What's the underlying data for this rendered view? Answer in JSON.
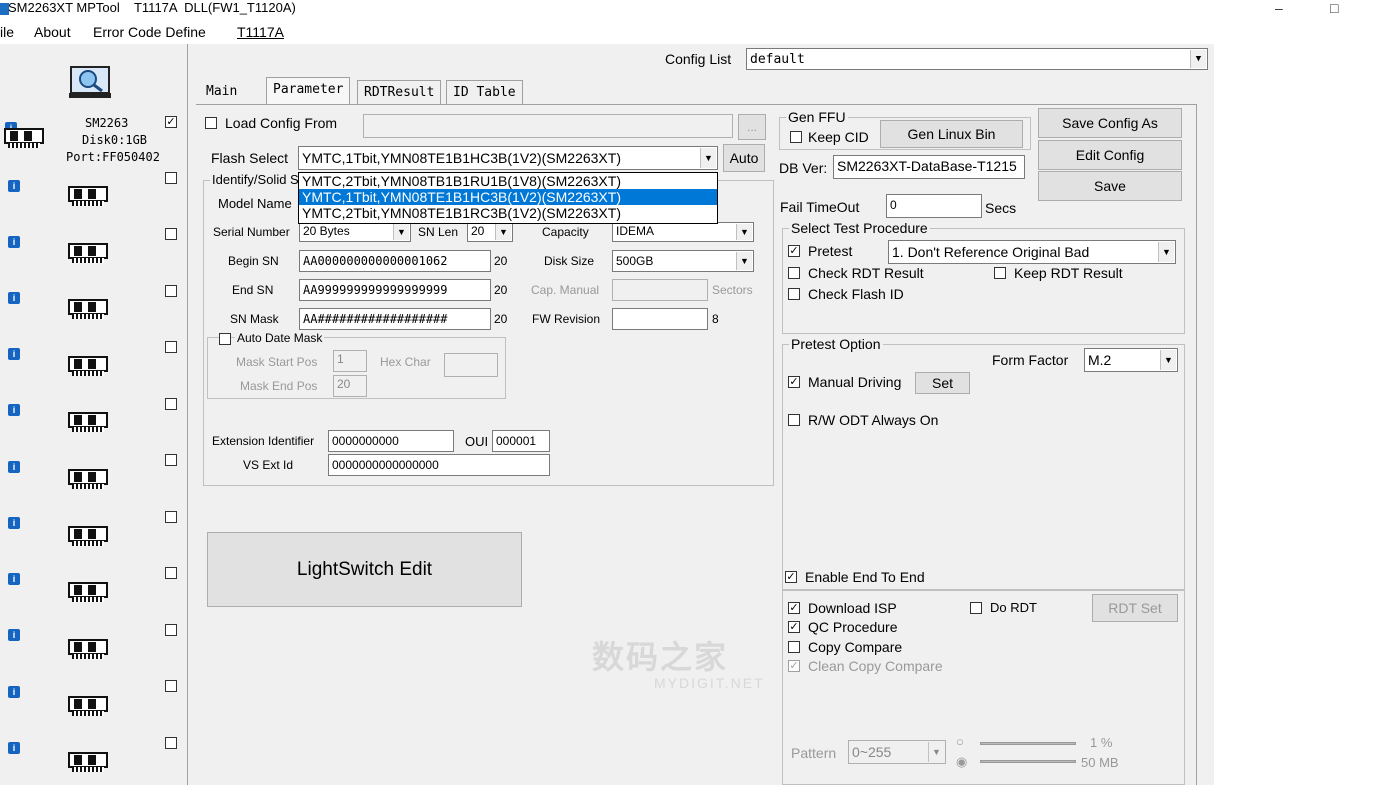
{
  "window": {
    "title": "SM2263XT MPTool    T1117A  DLL(FW1_T1120A)",
    "minimize": "–",
    "maximize": "□"
  },
  "menu": [
    "ile",
    "About",
    "Error Code Define",
    "T1117A"
  ],
  "config_list": {
    "label": "Config List",
    "value": "default"
  },
  "tabs": [
    "Main",
    "Parameter",
    "RDTResult",
    "ID Table"
  ],
  "left_panel": {
    "device0": {
      "model": "SM2263",
      "disk": "Disk0:1GB",
      "port": "Port:FF050402",
      "checked": "✓"
    },
    "info_glyph": "i"
  },
  "parameter": {
    "load_config_label": "Load Config From",
    "browse": "...",
    "flash_select_label": "Flash Select",
    "flash_select_value": "YMTC,1Tbit,YMN08TE1B1HC3B(1V2)(SM2263XT)",
    "auto_button": "Auto",
    "flash_options": [
      "YMTC,2Tbit,YMN08TB1B1RU1B(1V8)(SM2263XT)",
      "YMTC,1Tbit,YMN08TE1B1HC3B(1V2)(SM2263XT)",
      "YMTC,2Tbit,YMN08TE1B1RC3B(1V2)(SM2263XT)"
    ],
    "identify_group": "Identify/Solid S",
    "model_name_label": "Model Name",
    "serial_number_label": "Serial Number",
    "serial_number_value": "20 Bytes",
    "sn_len_label": "SN Len",
    "sn_len_value": "20",
    "capacity_label": "Capacity",
    "capacity_value": "IDEMA",
    "begin_sn_label": "Begin SN",
    "begin_sn_value": "AA000000000000001062",
    "begin_sn_len": "20",
    "disk_size_label": "Disk Size",
    "disk_size_value": "500GB",
    "end_sn_label": "End SN",
    "end_sn_value": "AA999999999999999999",
    "end_sn_len": "20",
    "cap_manual_label": "Cap. Manual",
    "sectors_label": "Sectors",
    "sn_mask_label": "SN Mask",
    "sn_mask_value": "AA##################",
    "sn_mask_len": "20",
    "fw_revision_label": "FW Revision",
    "fw_revision_len": "8",
    "auto_date_mask_label": "Auto Date Mask",
    "mask_start_pos_label": "Mask Start Pos",
    "mask_start_pos_value": "1",
    "hex_char_label": "Hex Char",
    "mask_end_pos_label": "Mask End Pos",
    "mask_end_pos_value": "20",
    "extension_identifier_label": "Extension Identifier",
    "extension_identifier_value": "0000000000",
    "oui_label": "OUI",
    "oui_value": "000001",
    "vs_ext_id_label": "VS Ext Id",
    "vs_ext_id_value": "0000000000000000",
    "lightswitch_button": "LightSwitch Edit"
  },
  "right": {
    "gen_ffu_group": "Gen FFU",
    "keep_cid_label": "Keep CID",
    "gen_linux_bin_button": "Gen Linux Bin",
    "save_config_as_button": "Save Config As",
    "edit_config_button": "Edit Config",
    "save_button": "Save",
    "db_ver_label": "DB Ver:",
    "db_ver_value": "SM2263XT-DataBase-T1215",
    "fail_timeout_label": "Fail TimeOut",
    "fail_timeout_value": "0",
    "secs_label": "Secs",
    "select_test_procedure_group": "Select Test Procedure",
    "pretest_label": "Pretest",
    "pretest_value": "1. Don't Reference Original Bad",
    "check_rdt_result_label": "Check RDT Result",
    "keep_rdt_result_label": "Keep RDT Result",
    "check_flash_id_label": "Check Flash ID",
    "pretest_option_group": "Pretest Option",
    "form_factor_label": "Form Factor",
    "form_factor_value": "M.2",
    "manual_driving_label": "Manual Driving",
    "set_button": "Set",
    "rw_odt_label": "R/W ODT Always On",
    "enable_end_to_end_label": "Enable End To End",
    "download_isp_label": "Download ISP",
    "do_rdt_label": "Do  RDT",
    "rdt_set_button": "RDT Set",
    "qc_procedure_label": "QC Procedure",
    "copy_compare_label": "Copy Compare",
    "clean_copy_compare_label": "Clean Copy Compare",
    "pattern_label": "Pattern",
    "pattern_value": "0~255",
    "slider1_value": "1 %",
    "slider2_value": "50 MB"
  },
  "watermark": {
    "cn": "数码之家",
    "en": "MYDIGIT.NET"
  },
  "colors": {
    "selection": "#0078d7",
    "info_icon": "#1565c0",
    "app_icon": "#1d6fc4"
  }
}
